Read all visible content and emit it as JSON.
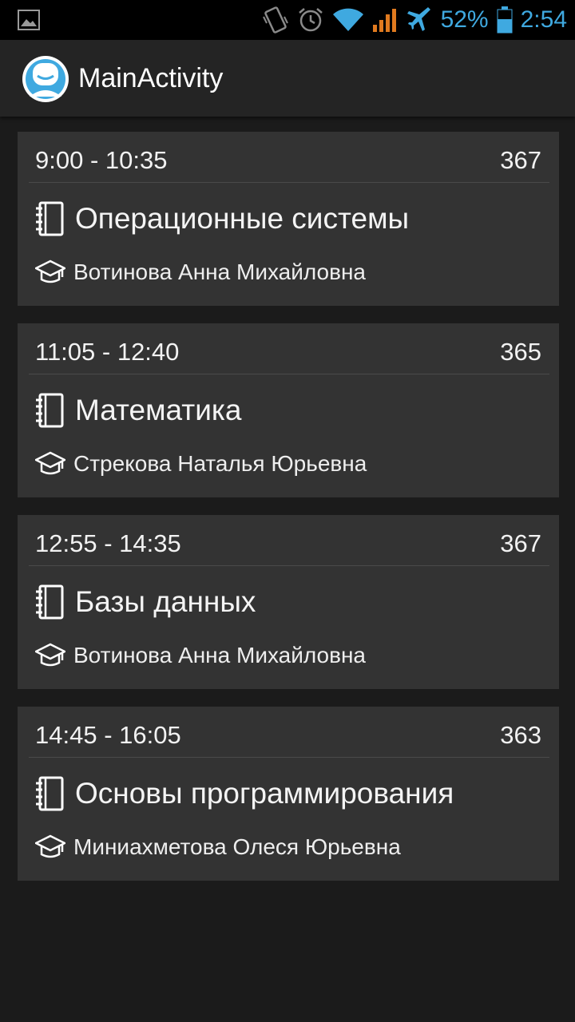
{
  "status_bar": {
    "battery_percent": "52%",
    "time": "2:54",
    "icons": [
      "image-icon",
      "vibrate-icon",
      "alarm-icon",
      "wifi-icon",
      "signal-icon",
      "airplane-icon",
      "battery-icon"
    ],
    "accent_color": "#3fa9e0"
  },
  "app_bar": {
    "title": "MainActivity",
    "logo_icon": "face-logo-icon"
  },
  "lessons": [
    {
      "time": "9:00 - 10:35",
      "room": "367",
      "subject": "Операционные системы",
      "teacher": "Вотинова Анна Михайловна"
    },
    {
      "time": "11:05 - 12:40",
      "room": "365",
      "subject": "Математика",
      "teacher": "Стрекова Наталья Юрьевна"
    },
    {
      "time": "12:55 - 14:35",
      "room": "367",
      "subject": "Базы данных",
      "teacher": "Вотинова Анна Михайловна"
    },
    {
      "time": "14:45 - 16:05",
      "room": "363",
      "subject": "Основы программирования",
      "teacher": "Миниахметова Олеся Юрьевна"
    }
  ]
}
